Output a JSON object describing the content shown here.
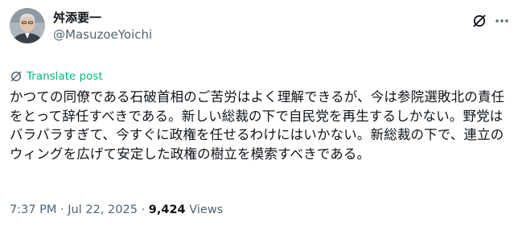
{
  "author": {
    "display_name": "舛添要一",
    "handle": "@MasuzoeYoichi"
  },
  "icons": {
    "grok": "grok-icon",
    "more": "more-icon",
    "translate": "translate-icon"
  },
  "translate": {
    "label": "Translate post"
  },
  "post": {
    "text": "かつての同僚である石破首相のご苦労はよく理解できるが、今は参院選敗北の責任をとって辞任すべきである。新しい総裁の下で自民党を再生するしかない。野党はバラバラすぎて、今すぐに政権を任せるわけにはいかない。新総裁の下で、連立のウィングを広げて安定した政権の樹立を模索すべきである。"
  },
  "meta": {
    "time": "7:37 PM",
    "separator": "·",
    "date": "Jul 22, 2025",
    "views_count": "9,424",
    "views_label": "Views"
  },
  "colors": {
    "text": "#0f1419",
    "secondary": "#536471",
    "translate": "#00ba7c"
  }
}
